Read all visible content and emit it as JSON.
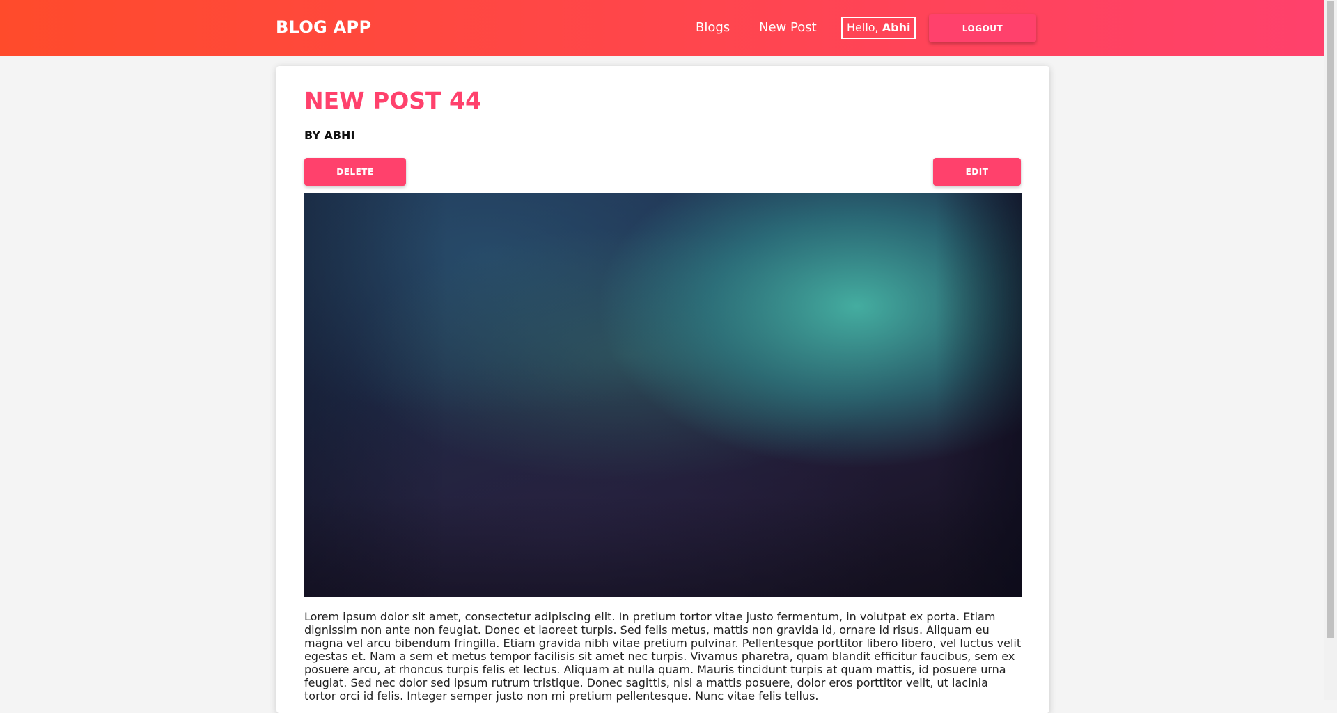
{
  "navbar": {
    "brand": "BLOG APP",
    "links": [
      "Blogs",
      "New Post"
    ],
    "greeting_prefix": "Hello,",
    "username": "Abhi",
    "logout_label": "LOGOUT"
  },
  "post": {
    "title": "NEW POST 44",
    "author": "BY ABHI",
    "delete_label": "DELETE",
    "edit_label": "EDIT",
    "body": "Lorem ipsum dolor sit amet, consectetur adipiscing elit. In pretium tortor vitae justo fermentum, in volutpat ex porta. Etiam dignissim non ante non feugiat. Donec et laoreet turpis. Sed felis metus, mattis non gravida id, ornare id risus. Aliquam eu magna vel arcu bibendum fringilla. Etiam gravida nibh vitae pretium pulvinar. Pellentesque porttitor libero libero, vel luctus velit egestas et. Nam a sem et metus tempor facilisis sit amet nec turpis. Vivamus pharetra, quam blandit efficitur faucibus, sem ex posuere arcu, at rhoncus turpis felis et lectus. Aliquam at nulla quam. Mauris tincidunt turpis at quam mattis, id posuere urna feugiat. Sed nec dolor sed ipsum rutrum tristique. Donec sagittis, nisi a mattis posuere, dolor eros porttitor velit, ut lacinia tortor orci id felis. Integer semper justo non mi pretium pellentesque. Nunc vitae felis tellus."
  },
  "colors": {
    "nav_gradient_start": "#ff4b2b",
    "nav_gradient_end": "#ff416c",
    "accent": "#ff416c",
    "page_background": "#f4f4f4"
  }
}
